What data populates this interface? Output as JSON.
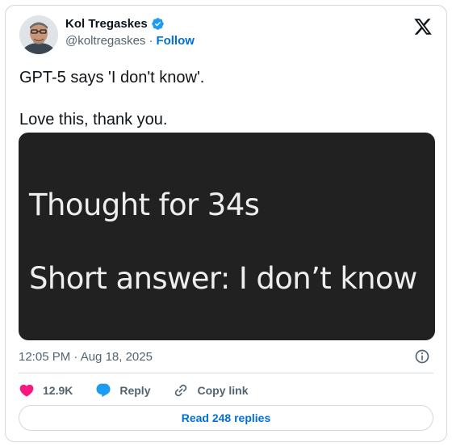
{
  "author": {
    "display_name": "Kol Tregaskes",
    "handle": "@koltregaskes",
    "separator": "·",
    "follow_label": "Follow"
  },
  "tweet": {
    "text": "GPT-5 says 'I don't know'.\n\nLove this, thank you."
  },
  "media": {
    "line1": "Thought for 34s",
    "line2": "Short answer: I don’t know"
  },
  "meta": {
    "timestamp": "12:05 PM · Aug 18, 2025"
  },
  "actions": {
    "like_count": "12.9K",
    "reply_label": "Reply",
    "copy_link_label": "Copy link"
  },
  "replies": {
    "label": "Read 248 replies"
  },
  "colors": {
    "accent": "#006fd6",
    "like": "#f91880",
    "verified": "#1d9bf0",
    "muted": "#536471",
    "media_bg": "#212121"
  },
  "icons": [
    "verified-badge-icon",
    "x-logo-icon",
    "info-icon",
    "heart-icon",
    "reply-bubble-icon",
    "link-icon"
  ]
}
